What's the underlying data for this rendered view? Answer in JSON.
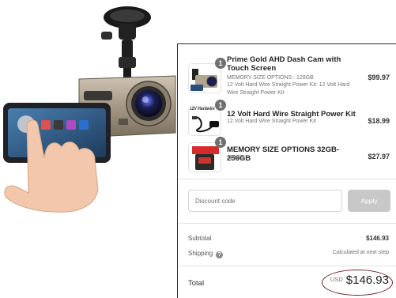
{
  "order": {
    "items": [
      {
        "title": "Prime Gold AHD Dash Cam with Touch Screen",
        "options": "MEMORY SIZE OPTIONS : 128GB",
        "addon": "12 Volt Hard Wire Straight Power Kit: 12 Volt Hard Wire Straight Power Kit",
        "price": "$99.97",
        "quantity": "1"
      },
      {
        "title": "12 Volt Hard Wire Straight Power Kit",
        "options": "12 Volt Hard Wire Straight Power Kit",
        "price": "$18.99",
        "quantity": "1",
        "thumb_label": "12V Hardwire"
      },
      {
        "title": "MEMORY SIZE OPTIONS 32GB-256GB",
        "options": "128GB",
        "price": "$27.97",
        "quantity": "1"
      }
    ]
  },
  "discount": {
    "placeholder": "Discount code",
    "apply_label": "Apply"
  },
  "summary": {
    "subtotal_label": "Subtotal",
    "subtotal_value": "$146.93",
    "shipping_label": "Shipping",
    "shipping_help_glyph": "?",
    "shipping_value": "Calculated at next step",
    "total_label": "Total",
    "currency": "USD",
    "total_value": "$146.93"
  },
  "colors": {
    "highlight_ring": "#7a1f2b",
    "apply_button": "#c8c8c8",
    "quantity_badge": "#707070"
  }
}
